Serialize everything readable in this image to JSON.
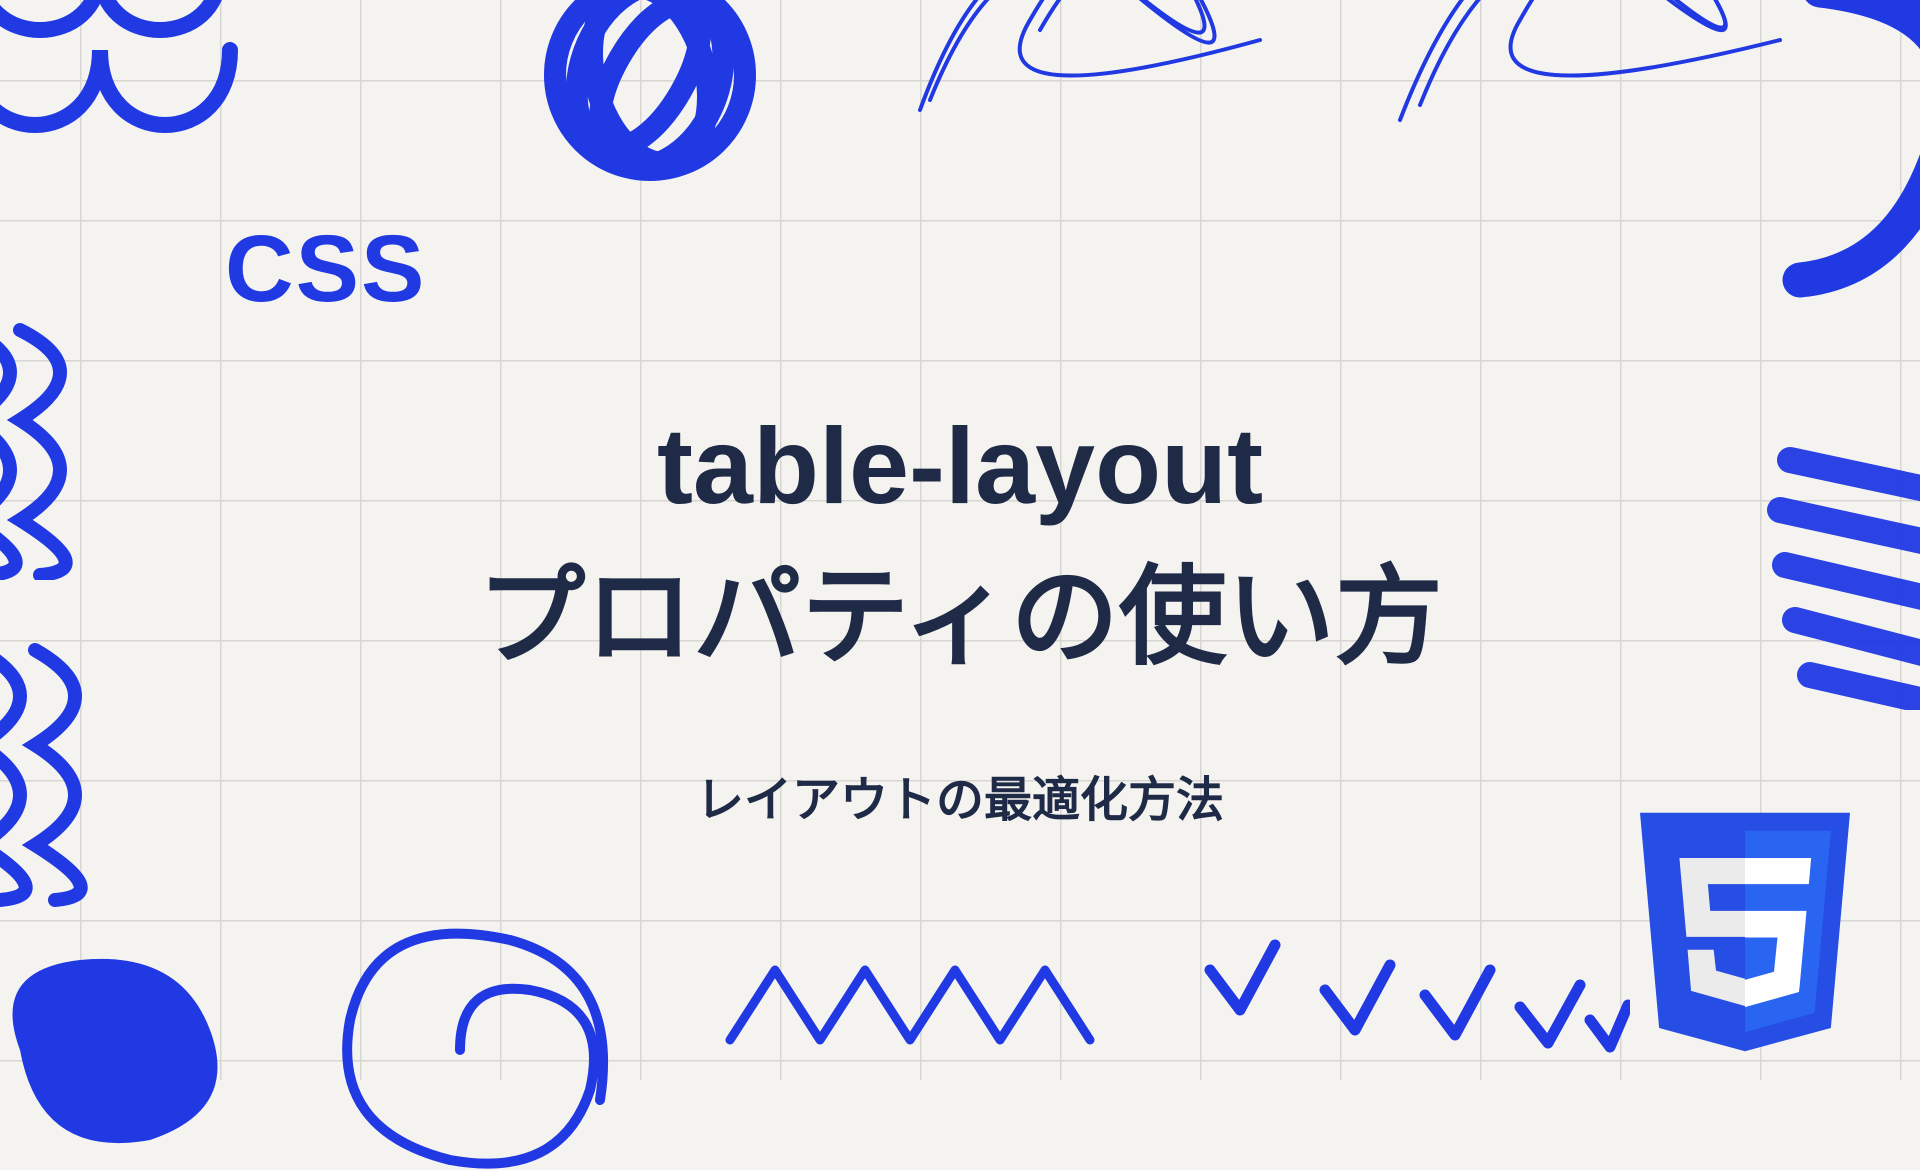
{
  "label": "CSS",
  "title_line1": "table-layout",
  "title_line2": "プロパティの使い方",
  "subtitle": "レイアウトの最適化方法",
  "logo_name": "css3-logo",
  "colors": {
    "accent": "#2039e3",
    "logo": "#264de4",
    "logo_light": "#2965f1",
    "text_dark": "#1f2a47",
    "background": "#f4f3f0",
    "grid": "#d8d6d2"
  }
}
